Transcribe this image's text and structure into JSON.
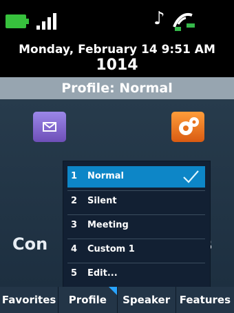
{
  "status": {
    "battery_icon": "battery-full-icon",
    "signal_icon": "signal-strength-icon",
    "note_icon": "music-note-icon",
    "status_icon": "headset-phone-icon",
    "note_glyph": "♪"
  },
  "header": {
    "date_time": "Monday, February 14 9:51 AM",
    "extension": "1014"
  },
  "profile_bar": {
    "title": "Profile: Normal"
  },
  "apps": [
    {
      "name": "messages-icon",
      "color": "#7c63c8"
    },
    {
      "name": "settings-icon",
      "color": "#e6711d"
    }
  ],
  "background_text": {
    "left": "Con",
    "right": "s"
  },
  "menu": {
    "items": [
      {
        "number": "1",
        "label": "Normal",
        "selected": true
      },
      {
        "number": "2",
        "label": "Silent",
        "selected": false
      },
      {
        "number": "3",
        "label": "Meeting",
        "selected": false
      },
      {
        "number": "4",
        "label": "Custom 1",
        "selected": false
      },
      {
        "number": "5",
        "label": "Edit...",
        "selected": false
      }
    ],
    "check_icon": "check-icon"
  },
  "softkeys": [
    {
      "label": "Favorites",
      "active": false
    },
    {
      "label": "Profile",
      "active": true
    },
    {
      "label": "Speaker",
      "active": false
    },
    {
      "label": "Features",
      "active": false
    }
  ],
  "colors": {
    "battery": "#37c13d",
    "selected_menu": "#0d86c7",
    "profile_bar": "#97a5b0",
    "active_softkey_marker": "#29a4ff"
  }
}
